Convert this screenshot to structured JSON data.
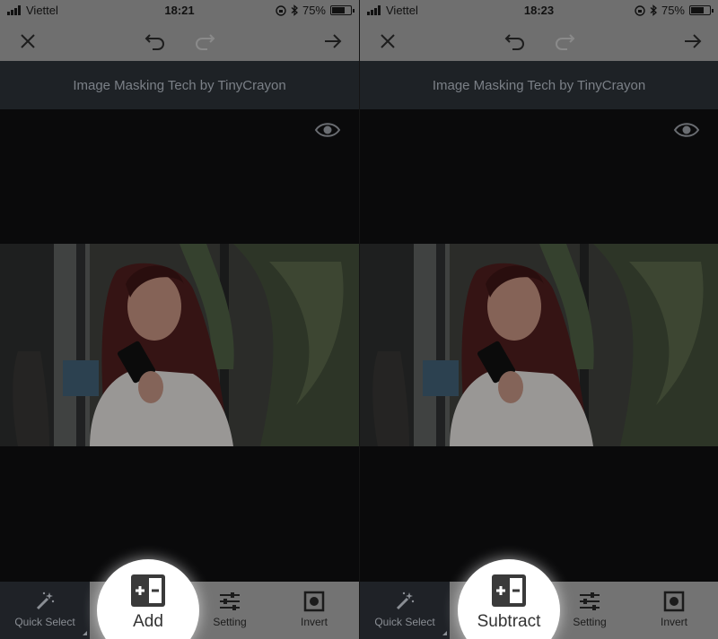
{
  "screens": [
    {
      "status": {
        "carrier": "Viettel",
        "time": "18:21",
        "battery": "75%",
        "battery_level": 0.75
      },
      "header": {
        "title": "Image Masking Tech by TinyCrayon"
      },
      "tools": {
        "quick_select": "Quick Select",
        "mode": "Add",
        "setting": "Setting",
        "invert": "Invert"
      }
    },
    {
      "status": {
        "carrier": "Viettel",
        "time": "18:23",
        "battery": "75%",
        "battery_level": 0.75
      },
      "header": {
        "title": "Image Masking Tech by TinyCrayon"
      },
      "tools": {
        "quick_select": "Quick Select",
        "mode": "Subtract",
        "setting": "Setting",
        "invert": "Invert"
      }
    }
  ],
  "icons": [
    "close-icon",
    "undo-icon",
    "redo-icon",
    "arrow-right-icon",
    "eye-icon",
    "magic-wand-icon",
    "add-subtract-icon",
    "sliders-icon",
    "invert-icon",
    "bluetooth-icon",
    "rotation-lock-icon"
  ],
  "colors": {
    "toolbar": "#6f6f6f",
    "header": "#1e2226",
    "canvas": "#0a0a0b",
    "selected_tool": "#1f2227"
  }
}
